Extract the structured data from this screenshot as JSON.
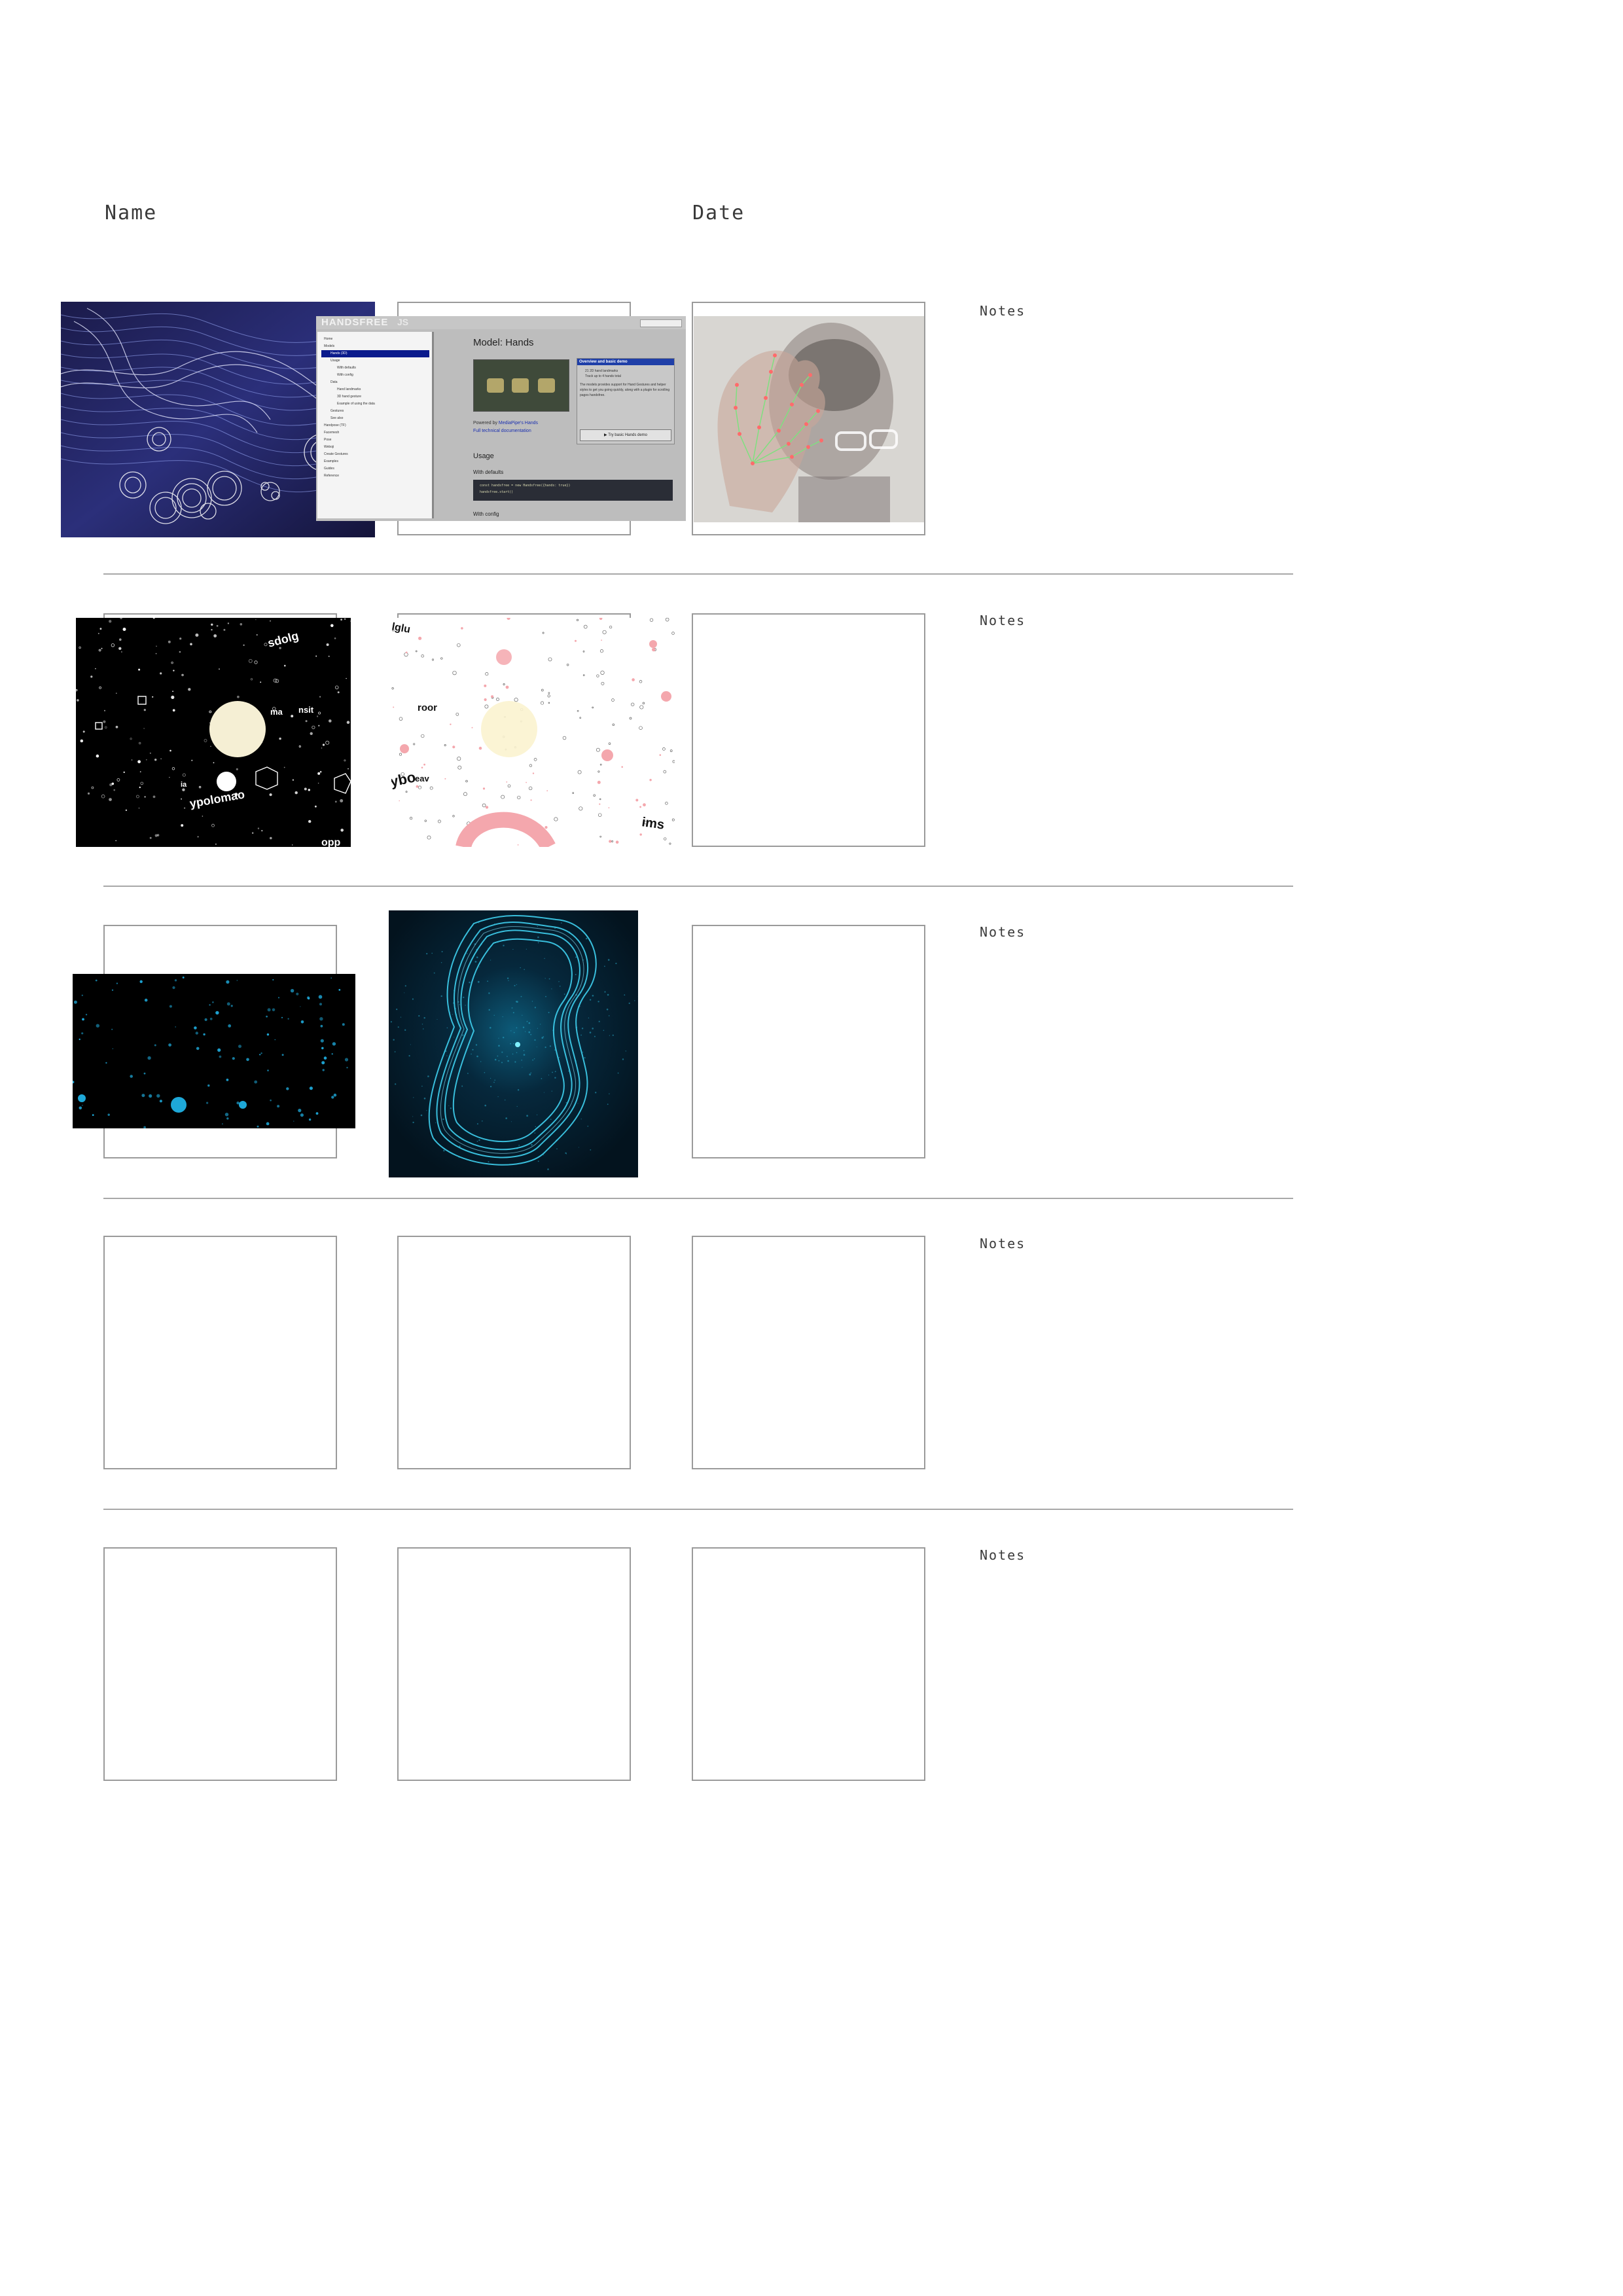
{
  "header": {
    "name_label": "Name",
    "date_label": "Date"
  },
  "rows": [
    {
      "notes_label": "Notes"
    },
    {
      "notes_label": "Notes"
    },
    {
      "notes_label": "Notes"
    },
    {
      "notes_label": "Notes"
    },
    {
      "notes_label": "Notes"
    }
  ],
  "screenshot_docs": {
    "logo": "HANDSFREE",
    "logo_version": "JS",
    "page_title": "Model: Hands",
    "nav_items": [
      "Home",
      "Models",
      "Hands (3D)",
      "Usage",
      "With defaults",
      "With config",
      "Data",
      "Hand landmarks",
      "3D hand gesture",
      "Example of using the data",
      "Gestures",
      "See also",
      "Handpose (TF)",
      "Facemesh",
      "Pose",
      "Weboji",
      "Create Gestures",
      "Examples",
      "Guides",
      "Reference"
    ],
    "powered_by_prefix": "Powered by",
    "powered_by_link": "MediaPipe's Hands",
    "full_docs_link": "Full technical documentation",
    "section_usage": "Usage",
    "section_with_defaults": "With defaults",
    "section_with_config": "With config",
    "code_line": "const handsfree = new Handsfree({hands: true})",
    "code_line_2": "handsfree.start()",
    "demo_panel_title": "Overview and basic demo",
    "demo_bullet_1": "21 2D hand landmarks",
    "demo_bullet_2": "Track up to 4 hands total",
    "demo_body": "The models provides support for Hand Gestures and helper styles to get you going quickly, along with a plugin for scrolling pages handsfree.",
    "demo_button": "Try basic Hands demo"
  },
  "art_words": {
    "space_dark": [
      "sdolg",
      "ma",
      "nsit",
      "ypolomao",
      "ia",
      "opp"
    ],
    "space_light": [
      "lglu",
      "roor",
      "ybo",
      "eav",
      "ims"
    ]
  },
  "colors": {
    "rule": "#a8a8a8",
    "box_border": "#9a9a9a",
    "text": "#3a3a3a",
    "docs_nav_active": "#0a1a8c",
    "cyan": "#1ea8d8"
  }
}
